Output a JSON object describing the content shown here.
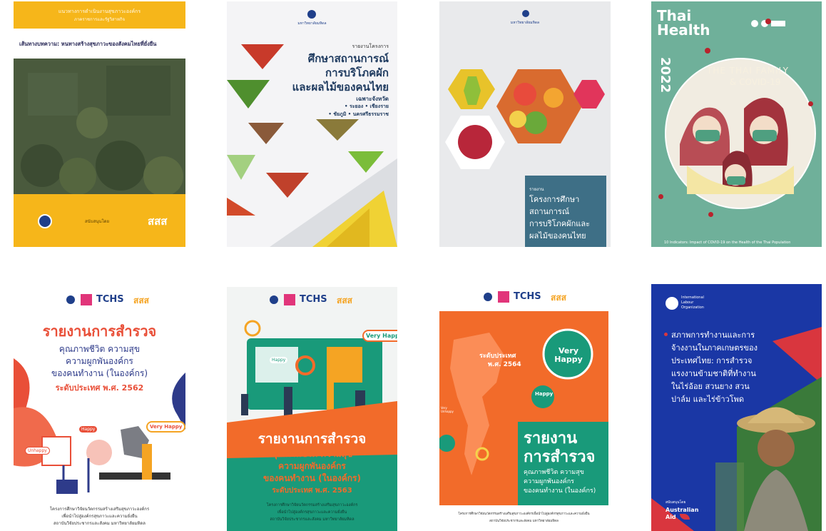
{
  "covers": [
    {
      "id": "c1",
      "header_line1": "แนวทางการดำเนินงานสุขภาวะองค์กร",
      "header_line2": "ภาคราชการและรัฐวิสาหกิจ",
      "subtitle": "เส้นทางบทความ: หนทางสร้างสุขภาวะของสังคมไทยที่ยั่งยืน",
      "footer_text": "สนับสนุนโดย",
      "brand": "สสส"
    },
    {
      "id": "c2",
      "logo_text": "มหาวิทยาลัยมหิดล",
      "kicker": "รายงานโครงการ",
      "title_lines": [
        "ศึกษาสถานการณ์",
        "การบริโภคผัก",
        "และผลไม้ของคนไทย"
      ],
      "region_label": "เฉพาะจังหวัด",
      "provinces": [
        "• ระยอง • เชียงราย",
        "• ชัยภูมิ • นครศรีธรรมราช"
      ]
    },
    {
      "id": "c3",
      "logo_text": "มหาวิทยาลัยมหิดล",
      "kicker": "รายงาน",
      "title_lines": [
        "โครงการศึกษา",
        "สถานการณ์",
        "การบริโภคผักและ",
        "ผลไม้ของคนไทย"
      ]
    },
    {
      "id": "c4",
      "brand_line1": "Thai",
      "brand_line2": "Health",
      "year": "2022",
      "arc_line1": "THE THAI FAMILY",
      "arc_line2": "& COVID-19",
      "footer": "10 Indicators: Impact of COVID-19 on the Health of the Thai Population"
    },
    {
      "id": "c5",
      "logo_tchs": "TCHS",
      "brand": "สสส",
      "title": "รายงานการสำรวจ",
      "lines": [
        "คุณภาพชีวิต ความสุข",
        "ความผูกพันองค์กร",
        "ของคนทำงาน (ในองค์กร)"
      ],
      "level": "ระดับประเทศ พ.ศ. 2562",
      "happy_tags": [
        "Very Happy",
        "Happy",
        "Unhappy"
      ],
      "footer_lines": [
        "โครงการศึกษาวิจัยนวัตกรรมสร้างเสริมสุขภาวะองค์กร",
        "เพื่อนำไปสู่องค์กรสุขภาวะและความยั่งยืน",
        "สถาบันวิจัยประชากรและสังคม มหาวิทยาลัยมหิดล"
      ]
    },
    {
      "id": "c6",
      "logo_tchs": "TCHS",
      "brand": "สสส",
      "title": "รายงานการสำรวจ",
      "lines": [
        "คุณภาพชีวิต ความสุข",
        "ความผูกพันองค์กร",
        "ของคนทำงาน (ในองค์กร)"
      ],
      "level": "ระดับประเทศ พ.ศ. 2563",
      "happy_tags": [
        "Very Happy",
        "Happy"
      ],
      "footer_lines": [
        "โครงการศึกษาวิจัยนวัตกรรมสร้างเสริมสุขภาวะองค์กร",
        "เพื่อนำไปสู่องค์กรสุขภาวะและความยั่งยืน",
        "สถาบันวิจัยประชากรและสังคม มหาวิทยาลัยมหิดล"
      ]
    },
    {
      "id": "c7",
      "logo_tchs": "TCHS",
      "brand": "สสส",
      "level_line1": "ระดับประเทศ",
      "level_line2": "พ.ศ. 2564",
      "very_happy": "Very Happy",
      "happy": "Happy",
      "small_tag": "Very Unhappy",
      "title_lines": [
        "รายงาน",
        "การสำรวจ"
      ],
      "lines": [
        "คุณภาพชีวิต ความสุข",
        "ความผูกพันองค์กร",
        "ของคนทำงาน (ในองค์กร)"
      ],
      "footer_lines": [
        "โครงการศึกษาวิจัยนวัตกรรมสร้างเสริมสุขภาวะองค์กรเพื่อนำไปสู่องค์กรสุขภาวะและความยั่งยืน",
        "สถาบันวิจัยประชากรและสังคม มหาวิทยาลัยมหิดล"
      ]
    },
    {
      "id": "c8",
      "org_lines": [
        "International",
        "Labour",
        "Organization"
      ],
      "title_lines": [
        "สภาพการทำงานและการ",
        "จ้างงานในภาคเกษตรของ",
        "ประเทศไทย: การสำรวจ",
        "แรงงานข้ามชาติที่ทำงาน",
        "ในไร่อ้อย สวนยาง สวน",
        "ปาล์ม และไร่ข้าวโพด"
      ],
      "supported_by": "สนับสนุนโดย",
      "sponsor_line1": "Australian",
      "sponsor_line2": "Aid"
    }
  ],
  "colors": {
    "thaihealth_orange": "#f6b61a",
    "green_dark": "#47573c",
    "teal": "#6fb09a",
    "red": "#d9363e",
    "orange": "#f26b2a",
    "navy": "#1a37a5",
    "green_report": "#199a7a"
  }
}
